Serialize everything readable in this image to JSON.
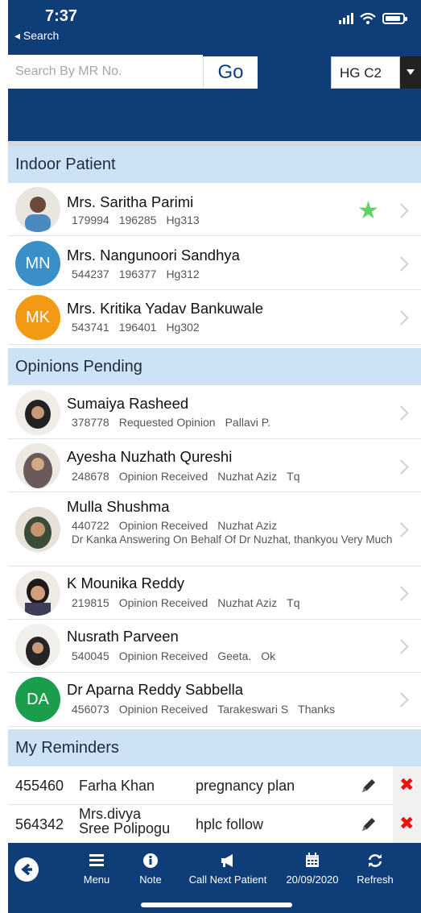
{
  "status": {
    "time": "7:37",
    "back": "◂ Search"
  },
  "search": {
    "placeholder": "Search By MR No.",
    "go_label": "Go",
    "ward": "HG C2"
  },
  "indoor": {
    "title": "Indoor Patient",
    "patients": [
      {
        "name": "Mrs. Saritha Parimi",
        "mr": "179994",
        "ip": "196285",
        "bed": "Hg313",
        "starred": true
      },
      {
        "name": "Mrs. Nangunoori Sandhya",
        "initials": "MN",
        "color": "#3a8fc9",
        "mr": "544237",
        "ip": "196377",
        "bed": "Hg312"
      },
      {
        "name": "Mrs. Kritika Yadav Bankuwale",
        "initials": "MK",
        "color": "#f39a14",
        "mr": "543741",
        "ip": "196401",
        "bed": "Hg302"
      }
    ]
  },
  "opinions": {
    "title": "Opinions Pending",
    "items": [
      {
        "name": "Sumaiya Rasheed",
        "mr": "378778",
        "status": "Requested Opinion",
        "doctor": "Pallavi P.",
        "note": ""
      },
      {
        "name": "Ayesha Nuzhath Qureshi",
        "mr": "248678",
        "status": "Opinion Received",
        "doctor": "Nuzhat Aziz",
        "note": "Tq"
      },
      {
        "name": "Mulla Shushma",
        "mr": "440722",
        "status": "Opinion Received",
        "doctor": "Nuzhat Aziz",
        "note": "Dr Kanka Answering On Behalf Of Dr Nuzhat, thankyou Very Much"
      },
      {
        "name": "K Mounika Reddy",
        "mr": "219815",
        "status": "Opinion Received",
        "doctor": "Nuzhat Aziz",
        "note": "Tq"
      },
      {
        "name": "Nusrath Parveen",
        "mr": "540045",
        "status": "Opinion Received",
        "doctor": "Geeta.",
        "note": "Ok"
      },
      {
        "name": "Dr Aparna Reddy Sabbella",
        "initials": "DA",
        "color": "#1a9e4b",
        "mr": "456073",
        "status": "Opinion Received",
        "doctor": "Tarakeswari S",
        "note": "Thanks"
      }
    ]
  },
  "reminders": {
    "title": "My Reminders",
    "items": [
      {
        "id": "455460",
        "name": "Farha Khan",
        "text": "pregnancy plan"
      },
      {
        "id": "564342",
        "name_line1": "Mrs.divya",
        "name_line2": "Sree Polipogu",
        "text": "hplc follow"
      }
    ]
  },
  "nav": {
    "menu": "Menu",
    "note": "Note",
    "call_next": "Call Next Patient",
    "date": "20/09/2020",
    "refresh": "Refresh"
  },
  "colors": {
    "primary": "#0e3d78",
    "section_bg": "#cde3f5",
    "star": "#5fd36a",
    "delete": "#e11111"
  }
}
